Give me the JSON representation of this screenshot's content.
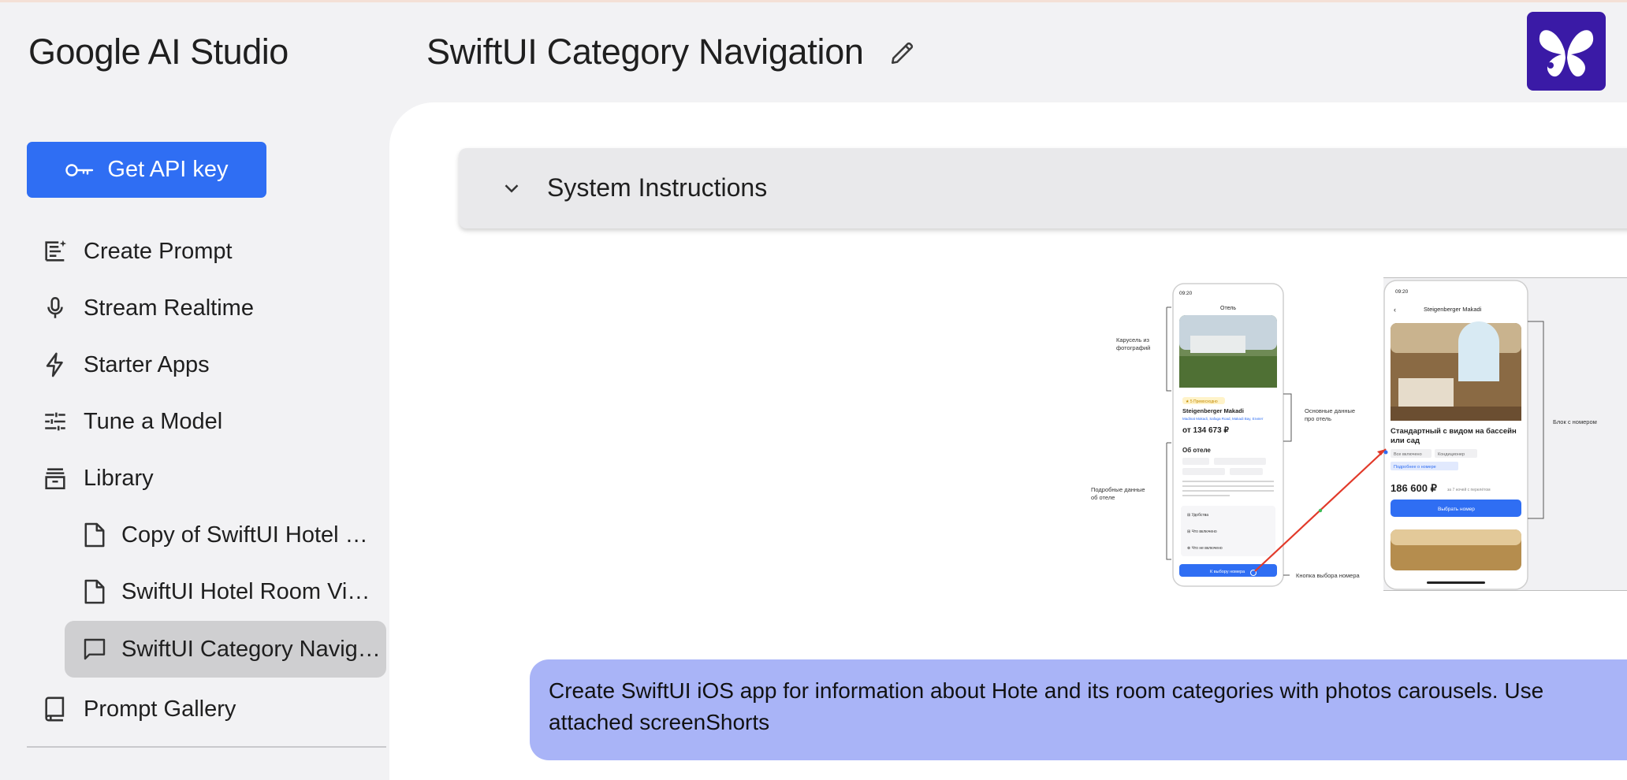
{
  "header": {
    "brand": "Google AI Studio",
    "title": "SwiftUI Category Navigation"
  },
  "sidebar": {
    "api_button": "Get API key",
    "items": [
      {
        "label": "Create Prompt",
        "icon": "create-prompt-icon"
      },
      {
        "label": "Stream Realtime",
        "icon": "microphone-icon"
      },
      {
        "label": "Starter Apps",
        "icon": "lightning-icon"
      },
      {
        "label": "Tune a Model",
        "icon": "sliders-icon"
      },
      {
        "label": "Library",
        "icon": "library-icon"
      },
      {
        "label": "Prompt Gallery",
        "icon": "book-icon"
      }
    ],
    "library_items": [
      {
        "label": "Copy of SwiftUI Hotel Ro...",
        "icon": "document-icon",
        "active": false
      },
      {
        "label": "SwiftUI Hotel Room View ...",
        "icon": "document-icon",
        "active": false
      },
      {
        "label": "SwiftUI Category Naviga...",
        "icon": "chat-icon",
        "active": true
      }
    ]
  },
  "main": {
    "system_instructions": "System Instructions",
    "attachment": {
      "annotations": [
        "Карусель из фотографий",
        "Основные данные про отель",
        "Подробные данные об отеле",
        "Кнопка выбора номера",
        "Блок с номером"
      ],
      "screen1": {
        "time": "09:20",
        "title": "Отель",
        "hotel_name": "Steigenberger Makadi",
        "price": "от 134 673 ₽",
        "about": "Об отеле",
        "button": "К выбору номера"
      },
      "screen2": {
        "time": "09:20",
        "title": "Steigenberger Makadi",
        "room_title": "Стандартный с видом на бассейн или сад",
        "tags": [
          "Все включено",
          "Кондиционер"
        ],
        "details_link": "Подробнее о номере",
        "price": "186 600 ₽",
        "button": "Выбрать номер"
      }
    },
    "prompt": "Create SwiftUI iOS app for information about Hote and its room categories with photos carousels. Use attached screenShorts"
  },
  "colors": {
    "accent": "#2f6ef3",
    "prompt_bubble": "#a9b4f7",
    "logo_bg": "#3a1aa6"
  }
}
